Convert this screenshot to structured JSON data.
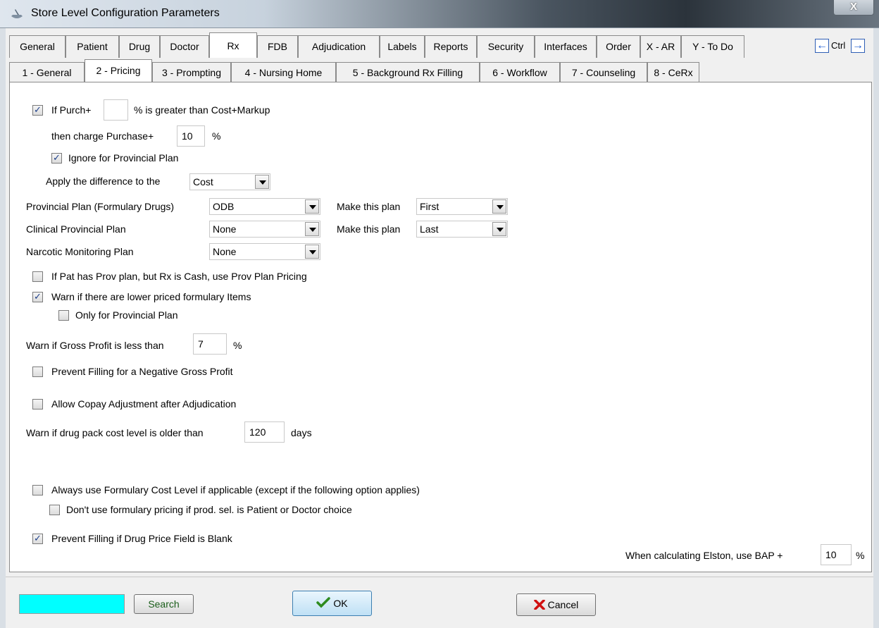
{
  "window": {
    "title": "Store Level Configuration Parameters",
    "close_label": "X"
  },
  "main_tabs": [
    {
      "label": "General"
    },
    {
      "label": "Patient"
    },
    {
      "label": "Drug"
    },
    {
      "label": "Doctor"
    },
    {
      "label": "Rx",
      "active": true
    },
    {
      "label": "FDB"
    },
    {
      "label": "Adjudication"
    },
    {
      "label": "Labels"
    },
    {
      "label": "Reports"
    },
    {
      "label": "Security"
    },
    {
      "label": "Interfaces"
    },
    {
      "label": "Order"
    },
    {
      "label": "X - AR"
    },
    {
      "label": "Y - To Do"
    }
  ],
  "ctrl_nav": {
    "label": "Ctrl",
    "prev_icon": "left-arrow-icon",
    "next_icon": "right-arrow-icon"
  },
  "sub_tabs": [
    {
      "label": "1 - General"
    },
    {
      "label": "2 - Pricing",
      "active": true
    },
    {
      "label": "3 - Prompting"
    },
    {
      "label": "4 - Nursing Home"
    },
    {
      "label": "5 - Background Rx Filling"
    },
    {
      "label": "6 - Workflow"
    },
    {
      "label": "7 - Counseling"
    },
    {
      "label": "8 - CeRx"
    }
  ],
  "pricing": {
    "purch_prefix": "If Purch+",
    "purch_value": "",
    "purch_suffix": "% is greater than Cost+Markup",
    "then_charge_label": "then charge Purchase+",
    "then_charge_value": "10",
    "then_charge_unit": "%",
    "ignore_prov_label": "Ignore for Provincial Plan",
    "apply_diff_label": "Apply the difference to the",
    "apply_diff_value": "Cost",
    "prov_plan_label": "Provincial Plan (Formulary Drugs)",
    "prov_plan_value": "ODB",
    "make_plan_label_1": "Make this plan",
    "make_plan_value_1": "First",
    "clinical_plan_label": "Clinical Provincial Plan",
    "clinical_plan_value": "None",
    "make_plan_label_2": "Make this plan",
    "make_plan_value_2": "Last",
    "narcotic_plan_label": "Narcotic Monitoring Plan",
    "narcotic_plan_value": "None",
    "pat_prov_cash_label": "If Pat has Prov plan, but Rx is Cash, use Prov Plan Pricing",
    "warn_lower_label": "Warn if there are lower priced formulary Items",
    "only_prov_label": "Only for Provincial Plan",
    "warn_gp_label": "Warn if Gross Profit is less than",
    "warn_gp_value": "7",
    "warn_gp_unit": "%",
    "prevent_neg_gp_label": "Prevent Filling for a Negative Gross Profit",
    "allow_copay_label": "Allow Copay Adjustment after Adjudication",
    "warn_pack_label": "Warn if drug pack cost level is older than",
    "warn_pack_value": "120",
    "warn_pack_unit": "days",
    "always_formulary_label": "Always use Formulary Cost Level if applicable (except if the following option applies)",
    "dont_use_formulary_label": "Don't use formulary pricing if prod. sel. is Patient or Doctor choice",
    "prevent_blank_label": "Prevent Filling if Drug Price Field is Blank",
    "elston_label": "When calculating Elston, use BAP +",
    "elston_value": "10",
    "elston_unit": "%"
  },
  "checkboxes": {
    "purch": true,
    "ignore_prov": true,
    "pat_prov_cash": false,
    "warn_lower": true,
    "only_prov": false,
    "prevent_neg_gp": false,
    "allow_copay": false,
    "always_formulary": false,
    "dont_use_formulary": false,
    "prevent_blank": true
  },
  "footer": {
    "search_value": "",
    "search_label": "Search",
    "ok_label": "OK",
    "ok_icon": "checkmark-icon",
    "cancel_label": "Cancel",
    "cancel_icon": "x-icon"
  },
  "colors": {
    "search_box": "#00ffff",
    "ok_check": "#2e8b1f",
    "cancel_x": "#d01010",
    "arrow": "#1e5bd0"
  }
}
